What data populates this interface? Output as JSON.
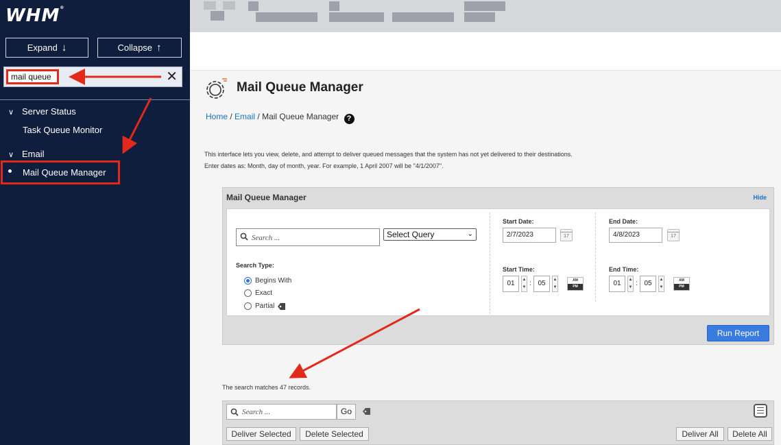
{
  "sidebar": {
    "logo": "WHM",
    "expand_label": "Expand",
    "collapse_label": "Collapse",
    "search_value": "mail queue",
    "sections": [
      {
        "label": "Server Status",
        "items": [
          "Task Queue Monitor"
        ]
      },
      {
        "label": "Email",
        "items": [
          "Mail Queue Manager"
        ]
      }
    ]
  },
  "page": {
    "title": "Mail Queue Manager",
    "breadcrumb": {
      "home": "Home",
      "sep": "/",
      "email": "Email",
      "current": "Mail Queue Manager"
    },
    "description1": "This interface lets you view, delete, and attempt to deliver queued messages that the system has not yet delivered to their destinations.",
    "description2": "Enter dates as: Month, day of month, year. For example, 1 April 2007 will be \"4/1/2007\"."
  },
  "panel": {
    "title": "Mail Queue Manager",
    "hide": "Hide",
    "search_placeholder": "Search ...",
    "select_query": "Select Query",
    "search_type_label": "Search Type:",
    "radios": [
      {
        "label": "Begins With",
        "selected": true
      },
      {
        "label": "Exact",
        "selected": false
      },
      {
        "label": "Partial",
        "selected": false
      }
    ],
    "start_date_label": "Start Date:",
    "start_date": "2/7/2023",
    "end_date_label": "End Date:",
    "end_date": "4/8/2023",
    "start_time_label": "Start Time:",
    "end_time_label": "End Time:",
    "start_hour": "01",
    "start_minute": "05",
    "end_hour": "01",
    "end_minute": "05",
    "am": "AM",
    "pm": "PM",
    "calendar_day": "17",
    "run_report": "Run Report"
  },
  "results": {
    "matches": "The search matches 47 records.",
    "search_placeholder": "Search ...",
    "go": "Go",
    "deliver_selected": "Deliver Selected",
    "delete_selected": "Delete Selected",
    "deliver_all": "Deliver All",
    "delete_all": "Delete All"
  },
  "colors": {
    "sidebar_bg": "#0f1e3d",
    "accent": "#3a7be0",
    "annotation": "#e12a1c",
    "link": "#1a72c3"
  }
}
